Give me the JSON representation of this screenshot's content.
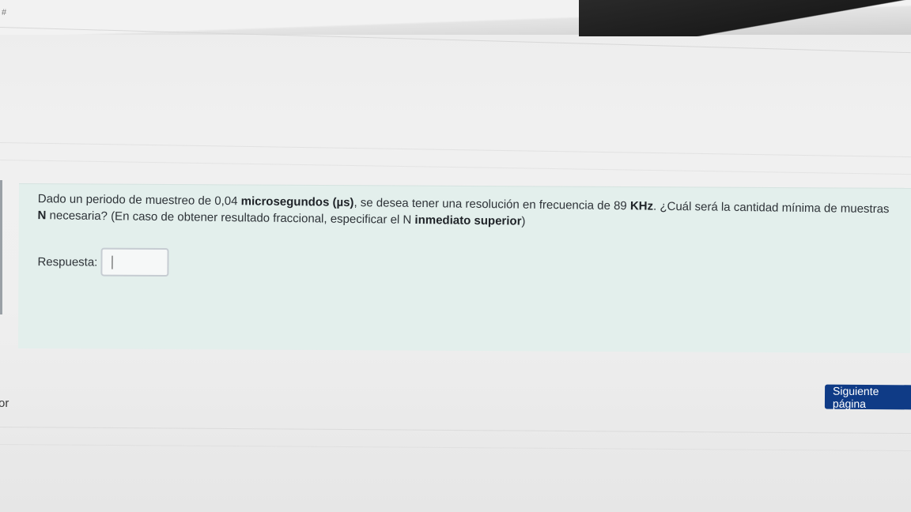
{
  "header": {
    "hash_mark": "#"
  },
  "question": {
    "text_part1": "Dado un periodo de muestreo de 0,04 ",
    "bold1": "microsegundos (µs)",
    "text_part2": ", se desea tener una resolución en frecuencia de 89 ",
    "bold2": "KHz",
    "text_part3": ". ¿Cuál será la cantidad mínima de muestras ",
    "bold3": "N",
    "text_part4": " necesaria? (En caso de obtener resultado fraccional, especificar el N ",
    "bold4": "inmediato superior",
    "text_part5": ")"
  },
  "answer": {
    "label": "Respuesta:",
    "value": ""
  },
  "navigation": {
    "next_label": "Siguiente página"
  },
  "sidebar": {
    "partial_text": "or"
  },
  "colors": {
    "question_bg": "#e3efec",
    "button_bg": "#0f3b86"
  }
}
